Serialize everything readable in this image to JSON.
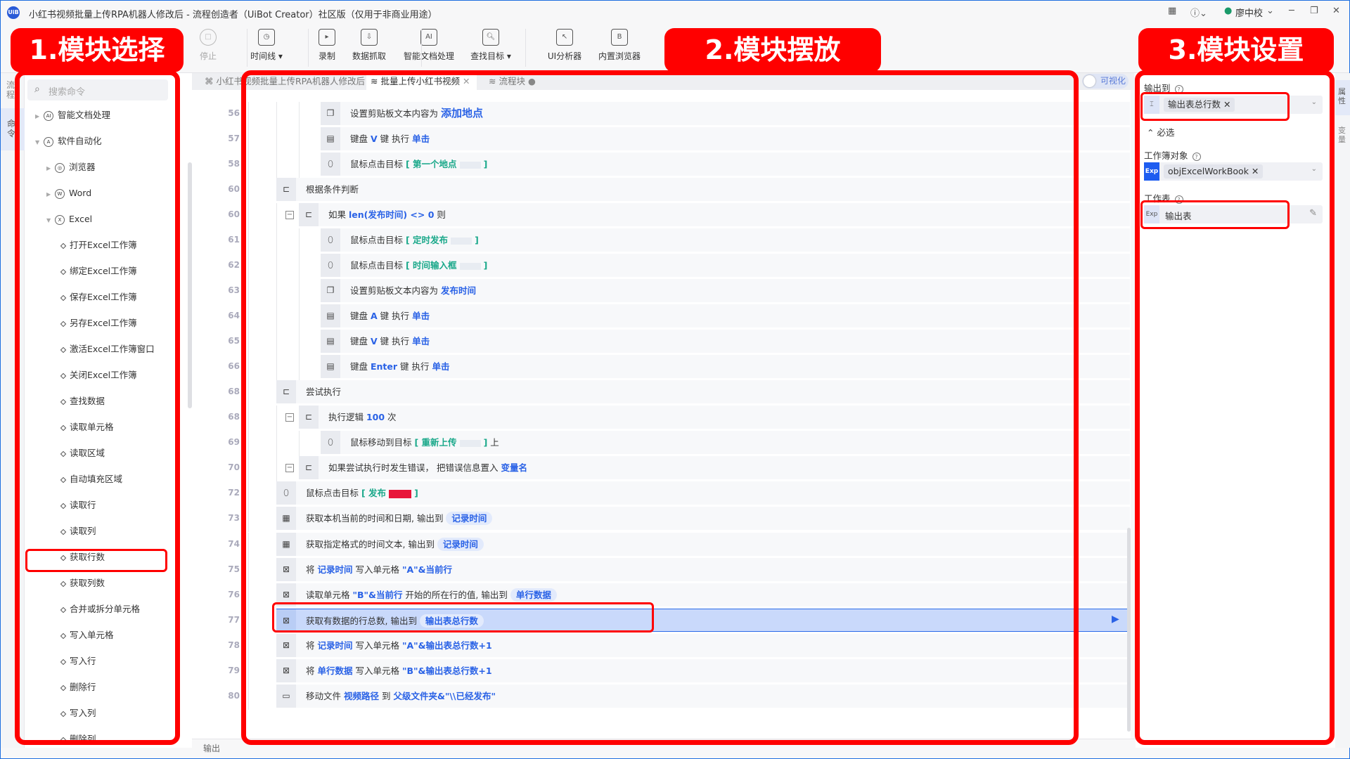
{
  "window": {
    "title": "小红书视频批量上传RPA机器人修改后 - 流程创造者（UiBot Creator）社区版（仅用于非商业用途）",
    "logo": "UiB",
    "user": "廖中校",
    "status_color": "#1a9a6a"
  },
  "toolbar": [
    {
      "label": "停止",
      "icon": "stop-icon",
      "glyph": "□",
      "disabled": true
    },
    {
      "label": "时间线 ▾",
      "icon": "clock-icon",
      "glyph": "◷"
    },
    {
      "label": "录制",
      "icon": "record-icon",
      "glyph": "▸"
    },
    {
      "label": "数据抓取",
      "icon": "data-scrape-icon",
      "glyph": "⇩"
    },
    {
      "label": "智能文档处理",
      "icon": "ai-doc-icon",
      "glyph": "AI"
    },
    {
      "label": "查找目标 ▾",
      "icon": "find-target-icon",
      "glyph": "🔍︎"
    },
    {
      "label": "UI分析器",
      "icon": "ui-analyzer-icon",
      "glyph": "↖"
    },
    {
      "label": "内置浏览器",
      "icon": "browser-icon",
      "glyph": "B"
    }
  ],
  "sidebar": {
    "search_placeholder": "搜索命令",
    "items": [
      {
        "label": "智能文档处理",
        "level": 0,
        "type": "group",
        "expanded": false,
        "icon": "ai-doc-icon",
        "glyph": "AI"
      },
      {
        "label": "软件自动化",
        "level": 0,
        "type": "group",
        "expanded": true,
        "icon": "automation-icon",
        "glyph": "A"
      },
      {
        "label": "浏览器",
        "level": 1,
        "type": "group",
        "expanded": false,
        "icon": "browser-icon",
        "glyph": "◎"
      },
      {
        "label": "Word",
        "level": 1,
        "type": "group",
        "expanded": false,
        "icon": "word-icon",
        "glyph": "W"
      },
      {
        "label": "Excel",
        "level": 1,
        "type": "group",
        "expanded": true,
        "icon": "excel-icon",
        "glyph": "X"
      },
      {
        "label": "打开Excel工作簿",
        "level": 2
      },
      {
        "label": "绑定Excel工作簿",
        "level": 2
      },
      {
        "label": "保存Excel工作簿",
        "level": 2
      },
      {
        "label": "另存Excel工作簿",
        "level": 2
      },
      {
        "label": "激活Excel工作簿窗口",
        "level": 2
      },
      {
        "label": "关闭Excel工作簿",
        "level": 2
      },
      {
        "label": "查找数据",
        "level": 2
      },
      {
        "label": "读取单元格",
        "level": 2
      },
      {
        "label": "读取区域",
        "level": 2
      },
      {
        "label": "自动填充区域",
        "level": 2
      },
      {
        "label": "读取行",
        "level": 2
      },
      {
        "label": "读取列",
        "level": 2
      },
      {
        "label": "获取行数",
        "level": 2
      },
      {
        "label": "获取列数",
        "level": 2
      },
      {
        "label": "合并或拆分单元格",
        "level": 2
      },
      {
        "label": "写入单元格",
        "level": 2
      },
      {
        "label": "写入行",
        "level": 2
      },
      {
        "label": "删除行",
        "level": 2
      },
      {
        "label": "写入列",
        "level": 2
      },
      {
        "label": "删除列",
        "level": 2
      }
    ]
  },
  "tabs": [
    {
      "label": "小红书视频批量上传RPA机器人修改后",
      "icon": "flowchart-icon",
      "active": false
    },
    {
      "label": "批量上传小红书视频",
      "icon": "layers-icon",
      "active": true,
      "closable": true
    },
    {
      "label": "流程块",
      "icon": "layers-icon",
      "active": false,
      "unsaved": true
    }
  ],
  "visual_toggle": {
    "label": "可视化",
    "on": false
  },
  "code_rows": [
    {
      "line": "56",
      "indent": 2,
      "icon": "clipboard-icon",
      "segs": [
        {
          "t": "设置剪贴板文本内容为 "
        },
        {
          "t": "添加地点",
          "c": "big"
        }
      ]
    },
    {
      "line": "57",
      "indent": 2,
      "icon": "keyboard-icon",
      "segs": [
        {
          "t": "键盘 "
        },
        {
          "t": "V",
          "c": "v"
        },
        {
          "t": " 键 执行 "
        },
        {
          "t": "单击",
          "c": "v"
        }
      ]
    },
    {
      "line": "58",
      "indent": 2,
      "icon": "mouse-icon",
      "segs": [
        {
          "t": "鼠标点击目标 "
        },
        {
          "t": "[ 第一个地点",
          "c": "g"
        },
        {
          "t": "",
          "c": "img"
        },
        {
          "t": "]",
          "c": "g"
        }
      ]
    },
    {
      "line": "60",
      "indent": 0,
      "icon": "condition-icon",
      "segs": [
        {
          "t": "根据条件判断"
        }
      ]
    },
    {
      "line": "60",
      "indent": 1,
      "icon": "condition-icon",
      "collapse": true,
      "segs": [
        {
          "t": "如果 "
        },
        {
          "t": "len(发布时间) <> 0",
          "c": "v"
        },
        {
          "t": " 则"
        }
      ]
    },
    {
      "line": "61",
      "indent": 2,
      "icon": "mouse-icon",
      "segs": [
        {
          "t": "鼠标点击目标 "
        },
        {
          "t": "[ 定时发布",
          "c": "g"
        },
        {
          "t": "",
          "c": "img"
        },
        {
          "t": "]",
          "c": "g"
        }
      ]
    },
    {
      "line": "62",
      "indent": 2,
      "icon": "mouse-icon",
      "segs": [
        {
          "t": "鼠标点击目标 "
        },
        {
          "t": "[ 时间输入框",
          "c": "g"
        },
        {
          "t": "",
          "c": "img"
        },
        {
          "t": "]",
          "c": "g"
        }
      ]
    },
    {
      "line": "63",
      "indent": 2,
      "icon": "clipboard-icon",
      "segs": [
        {
          "t": "设置剪贴板文本内容为 "
        },
        {
          "t": "发布时间",
          "c": "v"
        }
      ]
    },
    {
      "line": "64",
      "indent": 2,
      "icon": "keyboard-icon",
      "segs": [
        {
          "t": "键盘 "
        },
        {
          "t": "A",
          "c": "v"
        },
        {
          "t": " 键 执行 "
        },
        {
          "t": "单击",
          "c": "v"
        }
      ]
    },
    {
      "line": "65",
      "indent": 2,
      "icon": "keyboard-icon",
      "segs": [
        {
          "t": "键盘 "
        },
        {
          "t": "V",
          "c": "v"
        },
        {
          "t": " 键 执行 "
        },
        {
          "t": "单击",
          "c": "v"
        }
      ]
    },
    {
      "line": "66",
      "indent": 2,
      "icon": "keyboard-icon",
      "segs": [
        {
          "t": "键盘 "
        },
        {
          "t": "Enter",
          "c": "v"
        },
        {
          "t": " 键 执行 "
        },
        {
          "t": "单击",
          "c": "v"
        }
      ]
    },
    {
      "line": "68",
      "indent": 0,
      "icon": "condition-icon",
      "segs": [
        {
          "t": "尝试执行"
        }
      ]
    },
    {
      "line": "68",
      "indent": 1,
      "icon": "condition-icon",
      "collapse": true,
      "segs": [
        {
          "t": "执行逻辑 "
        },
        {
          "t": "100",
          "c": "v"
        },
        {
          "t": " 次"
        }
      ]
    },
    {
      "line": "69",
      "indent": 2,
      "icon": "mouse-icon",
      "segs": [
        {
          "t": "鼠标移动到目标 "
        },
        {
          "t": "[ 重新上传",
          "c": "g"
        },
        {
          "t": "",
          "c": "img"
        },
        {
          "t": "]",
          "c": "g"
        },
        {
          "t": " 上"
        }
      ]
    },
    {
      "line": "70",
      "indent": 1,
      "icon": "condition-icon",
      "collapse": true,
      "segs": [
        {
          "t": "如果尝试执行时发生错误， 把错误信息置入 "
        },
        {
          "t": "变量名",
          "c": "v"
        }
      ]
    },
    {
      "line": "72",
      "indent": 0,
      "icon": "mouse-icon",
      "segs": [
        {
          "t": "鼠标点击目标 "
        },
        {
          "t": "[ 发布",
          "c": "g"
        },
        {
          "t": "",
          "c": "red"
        },
        {
          "t": "]",
          "c": "g"
        }
      ]
    },
    {
      "line": "73",
      "indent": 0,
      "icon": "calendar-icon",
      "segs": [
        {
          "t": "获取本机当前的时间和日期, 输出到 "
        },
        {
          "t": "记录时间",
          "c": "p"
        }
      ]
    },
    {
      "line": "74",
      "indent": 0,
      "icon": "calendar-icon",
      "segs": [
        {
          "t": "获取指定格式的时间文本, 输出到 "
        },
        {
          "t": "记录时间",
          "c": "p"
        }
      ]
    },
    {
      "line": "75",
      "indent": 0,
      "icon": "excel-icon",
      "segs": [
        {
          "t": "将 "
        },
        {
          "t": "记录时间",
          "c": "v"
        },
        {
          "t": " 写入单元格 "
        },
        {
          "t": "\"A\"&当前行",
          "c": "v"
        }
      ]
    },
    {
      "line": "76",
      "indent": 0,
      "icon": "excel-icon",
      "segs": [
        {
          "t": "读取单元格 "
        },
        {
          "t": "\"B\"&当前行",
          "c": "v"
        },
        {
          "t": " 开始的所在行的值, 输出到 "
        },
        {
          "t": "单行数据",
          "c": "p"
        }
      ]
    },
    {
      "line": "77",
      "indent": 0,
      "icon": "excel-icon",
      "selected": true,
      "segs": [
        {
          "t": "获取有数据的行总数, 输出到 "
        },
        {
          "t": "输出表总行数",
          "c": "p"
        }
      ]
    },
    {
      "line": "78",
      "indent": 0,
      "icon": "excel-icon",
      "segs": [
        {
          "t": "将 "
        },
        {
          "t": "记录时间",
          "c": "v"
        },
        {
          "t": " 写入单元格 "
        },
        {
          "t": "\"A\"&输出表总行数+1",
          "c": "v"
        }
      ]
    },
    {
      "line": "79",
      "indent": 0,
      "icon": "excel-icon",
      "segs": [
        {
          "t": "将 "
        },
        {
          "t": "单行数据",
          "c": "v"
        },
        {
          "t": " 写入单元格 "
        },
        {
          "t": "\"B\"&输出表总行数+1",
          "c": "v"
        }
      ]
    },
    {
      "line": "80",
      "indent": 0,
      "icon": "file-icon",
      "segs": [
        {
          "t": "移动文件 "
        },
        {
          "t": "视频路径",
          "c": "v"
        },
        {
          "t": " 到 "
        },
        {
          "t": "父级文件夹&\"\\\\已经发布\"",
          "c": "v"
        }
      ]
    }
  ],
  "output_bar": {
    "label": "输出"
  },
  "properties": {
    "output_label": "输出到",
    "output_value": "输出表总行数",
    "required_section": "必选",
    "workbook_label": "工作簿对象",
    "workbook_prefix": "Exp",
    "workbook_value": "objExcelWorkBook",
    "sheet_label": "工作表",
    "sheet_prefix": "Exp",
    "sheet_value": "输出表"
  },
  "right_strip": {
    "tab1": "属性",
    "tab2": "变量"
  },
  "left_strip": {
    "tab1": "流程",
    "tab2": "命令"
  },
  "annotations": {
    "box1": "1.模块选择",
    "box2": "2.模块摆放",
    "box3": "3.模块设置",
    "color": "#ff0000"
  }
}
